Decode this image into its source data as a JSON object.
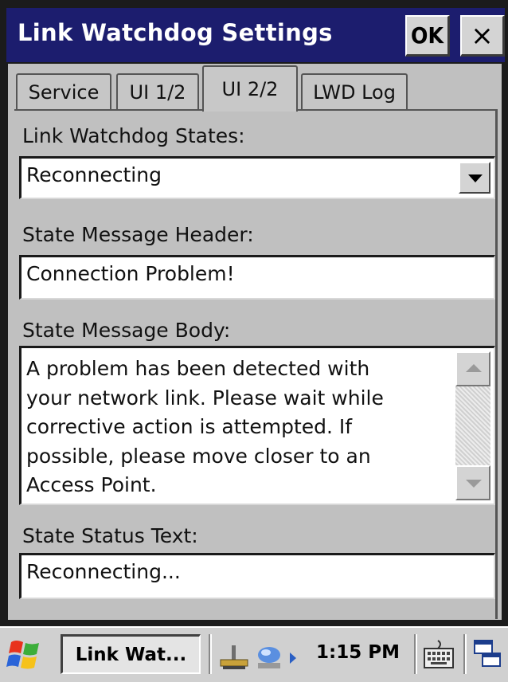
{
  "window": {
    "title": "Link Watchdog Settings",
    "ok_label": "OK",
    "close_label": "×"
  },
  "tabs": [
    {
      "label": "Service",
      "active": false
    },
    {
      "label": "UI 1/2",
      "active": false
    },
    {
      "label": "UI 2/2",
      "active": true
    },
    {
      "label": "LWD Log",
      "active": false
    }
  ],
  "form": {
    "states_label": "Link Watchdog States:",
    "states_value": "Reconnecting",
    "header_label": "State Message Header:",
    "header_value": "Connection Problem!",
    "body_label": "State Message Body:",
    "body_lines": [
      "A problem has been detected with",
      "your network link. Please wait while",
      "corrective action is attempted. If",
      "possible, please move closer to an",
      "Access Point."
    ],
    "status_label": "State Status Text:",
    "status_value": "Reconnecting..."
  },
  "taskbar": {
    "start_icon": "windows-flag-icon",
    "app_label": "Link Wat...",
    "tray_icons": [
      "network-connection-icon",
      "sync-icon",
      "arrow-icon"
    ],
    "time": "1:15 PM",
    "keyboard_icon": "keyboard-icon",
    "desktop_icon": "windows-switch-icon"
  },
  "colors": {
    "titlebar": "#1c1d6e",
    "client_bg": "#c0c0c0",
    "field_bg": "#ffffff"
  }
}
